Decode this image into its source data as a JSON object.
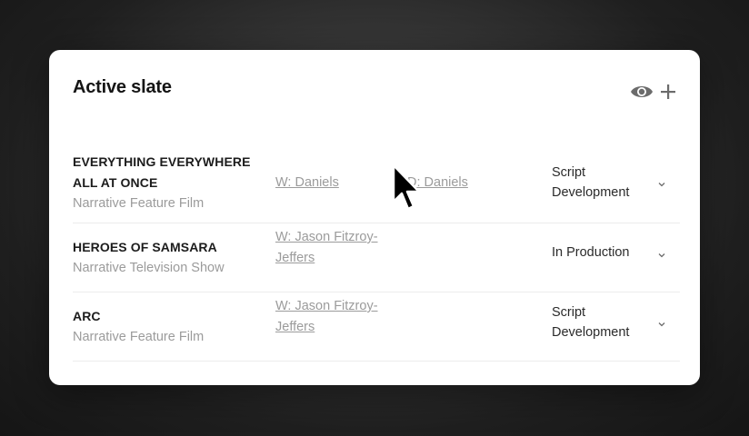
{
  "slate": {
    "title": "Active slate",
    "icons": [
      "eye-icon",
      "plus-icon"
    ]
  },
  "projects": [
    {
      "title_line1": "EVERYTHING EVERYWHERE",
      "title_line2": "ALL AT ONCE",
      "type": "Narrative Feature Film",
      "writer": "W: Daniels",
      "director": "D: Daniels",
      "status_line1": "Script",
      "status_line2": "Development"
    },
    {
      "title_line1": "HEROES OF SAMSARA",
      "title_line2": "",
      "type": "Narrative Television Show",
      "writer_line1": "W: Jason Fitzroy-",
      "writer_line2": "Jeffers",
      "status_line1": "In Production"
    },
    {
      "title_line1": "ARC",
      "title_line2": "",
      "type": "Narrative Feature Film",
      "writer_line1": "W: Jason Fitzroy-",
      "writer_line2": "Jeffers",
      "status_line1": "Script",
      "status_line2": "Development"
    }
  ],
  "colors": {
    "card_bg": "#ffffff",
    "title_text": "#151515",
    "muted_text": "#9b9b9b",
    "icon": "#6b6b6b"
  }
}
